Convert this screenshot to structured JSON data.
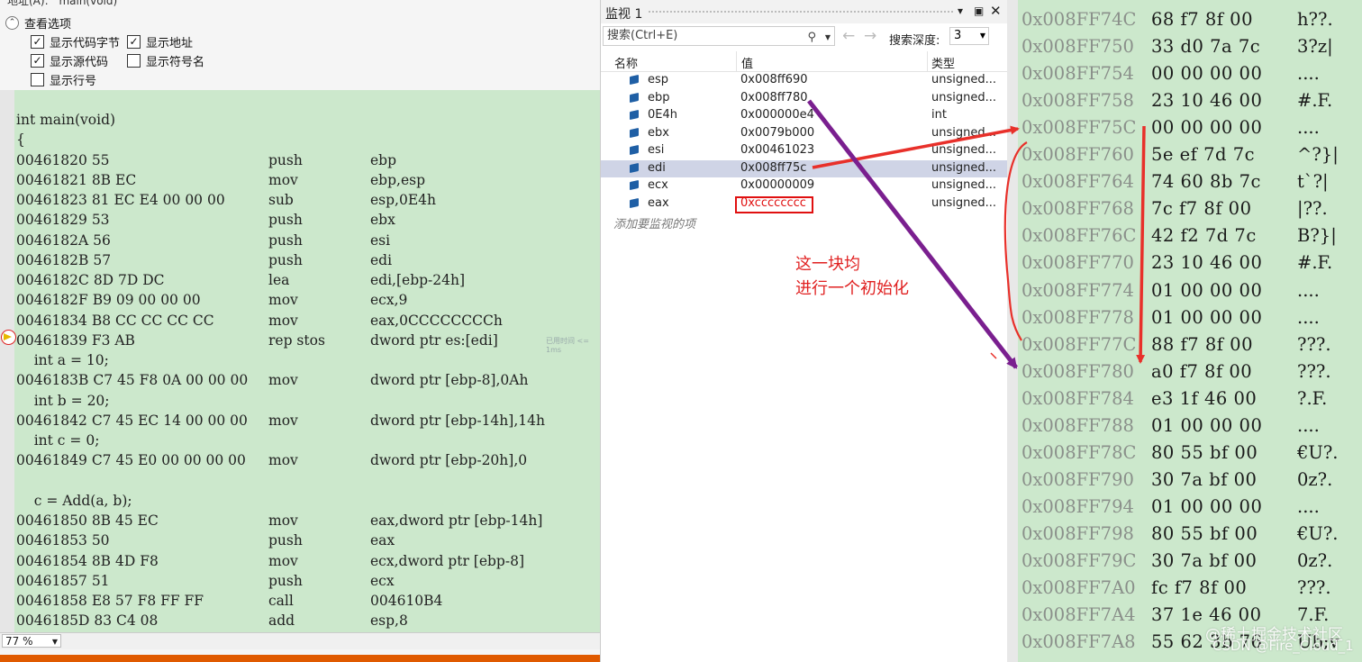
{
  "address_bar": {
    "label": "地址(A):",
    "value": "main(void)"
  },
  "view_options": {
    "header": "查看选项",
    "show_code_bytes": {
      "label": "显示代码字节",
      "checked": true
    },
    "show_address": {
      "label": "显示地址",
      "checked": true
    },
    "show_source": {
      "label": "显示源代码",
      "checked": true
    },
    "show_symbol_names": {
      "label": "显示符号名",
      "checked": false
    },
    "show_line_numbers": {
      "label": "显示行号",
      "checked": false
    }
  },
  "disassembly": {
    "lines": [
      {
        "type": "src",
        "text": "int main(void)"
      },
      {
        "type": "src",
        "text": "{"
      },
      {
        "type": "asm",
        "addr": "00461820 55",
        "mn": "push",
        "op": "ebp"
      },
      {
        "type": "asm",
        "addr": "00461821 8B EC",
        "mn": "mov",
        "op": "ebp,esp"
      },
      {
        "type": "asm",
        "addr": "00461823 81 EC E4 00 00 00",
        "mn": "sub",
        "op": "esp,0E4h"
      },
      {
        "type": "asm",
        "addr": "00461829 53",
        "mn": "push",
        "op": "ebx"
      },
      {
        "type": "asm",
        "addr": "0046182A 56",
        "mn": "push",
        "op": "esi"
      },
      {
        "type": "asm",
        "addr": "0046182B 57",
        "mn": "push",
        "op": "edi"
      },
      {
        "type": "asm",
        "addr": "0046182C 8D 7D DC",
        "mn": "lea",
        "op": "edi,[ebp-24h]"
      },
      {
        "type": "asm",
        "addr": "0046182F B9 09 00 00 00",
        "mn": "mov",
        "op": "ecx,9"
      },
      {
        "type": "asm",
        "addr": "00461834 B8 CC CC CC CC",
        "mn": "mov",
        "op": "eax,0CCCCCCCCh"
      },
      {
        "type": "asm",
        "addr": "00461839 F3 AB",
        "mn": "rep stos",
        "op": "dword ptr es:[edi]"
      },
      {
        "type": "src",
        "text": "    int a = 10;"
      },
      {
        "type": "asm",
        "addr": "0046183B C7 45 F8 0A 00 00 00",
        "mn": "mov",
        "op": "dword ptr [ebp-8],0Ah"
      },
      {
        "type": "src",
        "text": "    int b = 20;"
      },
      {
        "type": "asm",
        "addr": "00461842 C7 45 EC 14 00 00 00",
        "mn": "mov",
        "op": "dword ptr [ebp-14h],14h"
      },
      {
        "type": "src",
        "text": "    int c = 0;"
      },
      {
        "type": "asm",
        "addr": "00461849 C7 45 E0 00 00 00 00",
        "mn": "mov",
        "op": "dword ptr [ebp-20h],0"
      },
      {
        "type": "src",
        "text": ""
      },
      {
        "type": "src",
        "text": "    c = Add(a, b);"
      },
      {
        "type": "asm",
        "addr": "00461850 8B 45 EC",
        "mn": "mov",
        "op": "eax,dword ptr [ebp-14h]"
      },
      {
        "type": "asm",
        "addr": "00461853 50",
        "mn": "push",
        "op": "eax"
      },
      {
        "type": "asm",
        "addr": "00461854 8B 4D F8",
        "mn": "mov",
        "op": "ecx,dword ptr [ebp-8]"
      },
      {
        "type": "asm",
        "addr": "00461857 51",
        "mn": "push",
        "op": "ecx"
      },
      {
        "type": "asm",
        "addr": "00461858 E8 57 F8 FF FF",
        "mn": "call",
        "op": "004610B4"
      },
      {
        "type": "asm",
        "addr": "0046185D 83 C4 08",
        "mn": "add",
        "op": "esp,8"
      }
    ],
    "current_line_index": 11,
    "elapsed_hint": "已用时间 <= 1ms"
  },
  "zoom": {
    "value": "77 %"
  },
  "watch": {
    "title": "监视 1",
    "search_placeholder": "搜索(Ctrl+E)",
    "search_depth_label": "搜索深度:",
    "search_depth_value": "3",
    "columns": {
      "name": "名称",
      "value": "值",
      "type": "类型"
    },
    "rows": [
      {
        "name": "esp",
        "value": "0x008ff690",
        "type": "unsigned..."
      },
      {
        "name": "ebp",
        "value": "0x008ff780",
        "type": "unsigned..."
      },
      {
        "name": "0E4h",
        "value": "0x000000e4",
        "type": "int"
      },
      {
        "name": "ebx",
        "value": "0x0079b000",
        "type": "unsigned..."
      },
      {
        "name": "esi",
        "value": "0x00461023",
        "type": "unsigned..."
      },
      {
        "name": "edi",
        "value": "0x008ff75c",
        "type": "unsigned..."
      },
      {
        "name": "ecx",
        "value": "0x00000009",
        "type": "unsigned..."
      },
      {
        "name": "eax",
        "value": "0xcccccccc",
        "type": "unsigned..."
      }
    ],
    "selected_row_index": 5,
    "add_watch_hint": "添加要监视的项"
  },
  "annotation": {
    "line1": "这一块均",
    "line2": "进行一个初始化",
    "color": "#e02020"
  },
  "memory": {
    "rows": [
      {
        "addr": "0x008FF74C",
        "bytes": "68 f7 8f 00",
        "ascii": "h??."
      },
      {
        "addr": "0x008FF750",
        "bytes": "33 d0 7a 7c",
        "ascii": "3?z|"
      },
      {
        "addr": "0x008FF754",
        "bytes": "00 00 00 00",
        "ascii": "...."
      },
      {
        "addr": "0x008FF758",
        "bytes": "23 10 46 00",
        "ascii": "#.F."
      },
      {
        "addr": "0x008FF75C",
        "bytes": "00 00 00 00",
        "ascii": "...."
      },
      {
        "addr": "0x008FF760",
        "bytes": "5e ef 7d 7c",
        "ascii": "^?}|"
      },
      {
        "addr": "0x008FF764",
        "bytes": "74 60 8b 7c",
        "ascii": "t`?|"
      },
      {
        "addr": "0x008FF768",
        "bytes": "7c f7 8f 00",
        "ascii": "|??."
      },
      {
        "addr": "0x008FF76C",
        "bytes": "42 f2 7d 7c",
        "ascii": "B?}|"
      },
      {
        "addr": "0x008FF770",
        "bytes": "23 10 46 00",
        "ascii": "#.F."
      },
      {
        "addr": "0x008FF774",
        "bytes": "01 00 00 00",
        "ascii": "...."
      },
      {
        "addr": "0x008FF778",
        "bytes": "01 00 00 00",
        "ascii": "...."
      },
      {
        "addr": "0x008FF77C",
        "bytes": "88 f7 8f 00",
        "ascii": "???."
      },
      {
        "addr": "0x008FF780",
        "bytes": "a0 f7 8f 00",
        "ascii": "???."
      },
      {
        "addr": "0x008FF784",
        "bytes": "e3 1f 46 00",
        "ascii": "?.F."
      },
      {
        "addr": "0x008FF788",
        "bytes": "01 00 00 00",
        "ascii": "...."
      },
      {
        "addr": "0x008FF78C",
        "bytes": "80 55 bf 00",
        "ascii": "€U?."
      },
      {
        "addr": "0x008FF790",
        "bytes": "30 7a bf 00",
        "ascii": "0z?."
      },
      {
        "addr": "0x008FF794",
        "bytes": "01 00 00 00",
        "ascii": "...."
      },
      {
        "addr": "0x008FF798",
        "bytes": "80 55 bf 00",
        "ascii": "€U?."
      },
      {
        "addr": "0x008FF79C",
        "bytes": "30 7a bf 00",
        "ascii": "0z?."
      },
      {
        "addr": "0x008FF7A0",
        "bytes": "fc f7 8f 00",
        "ascii": "???."
      },
      {
        "addr": "0x008FF7A4",
        "bytes": "37 1e 46 00",
        "ascii": "7.F."
      },
      {
        "addr": "0x008FF7A8",
        "bytes": "55 62 3b 76",
        "ascii": "Ub;v"
      }
    ]
  },
  "watermark": {
    "line1": "@稀土掘金技术社区",
    "line2": "CSDN @Fire_Cloud_1"
  },
  "colors": {
    "code_bg": "#cce8cc",
    "selection": "#cfd4e6",
    "red_arrow": "#e8302a",
    "purple_arrow": "#7a1f8f",
    "accent_bar": "#e05a00"
  }
}
